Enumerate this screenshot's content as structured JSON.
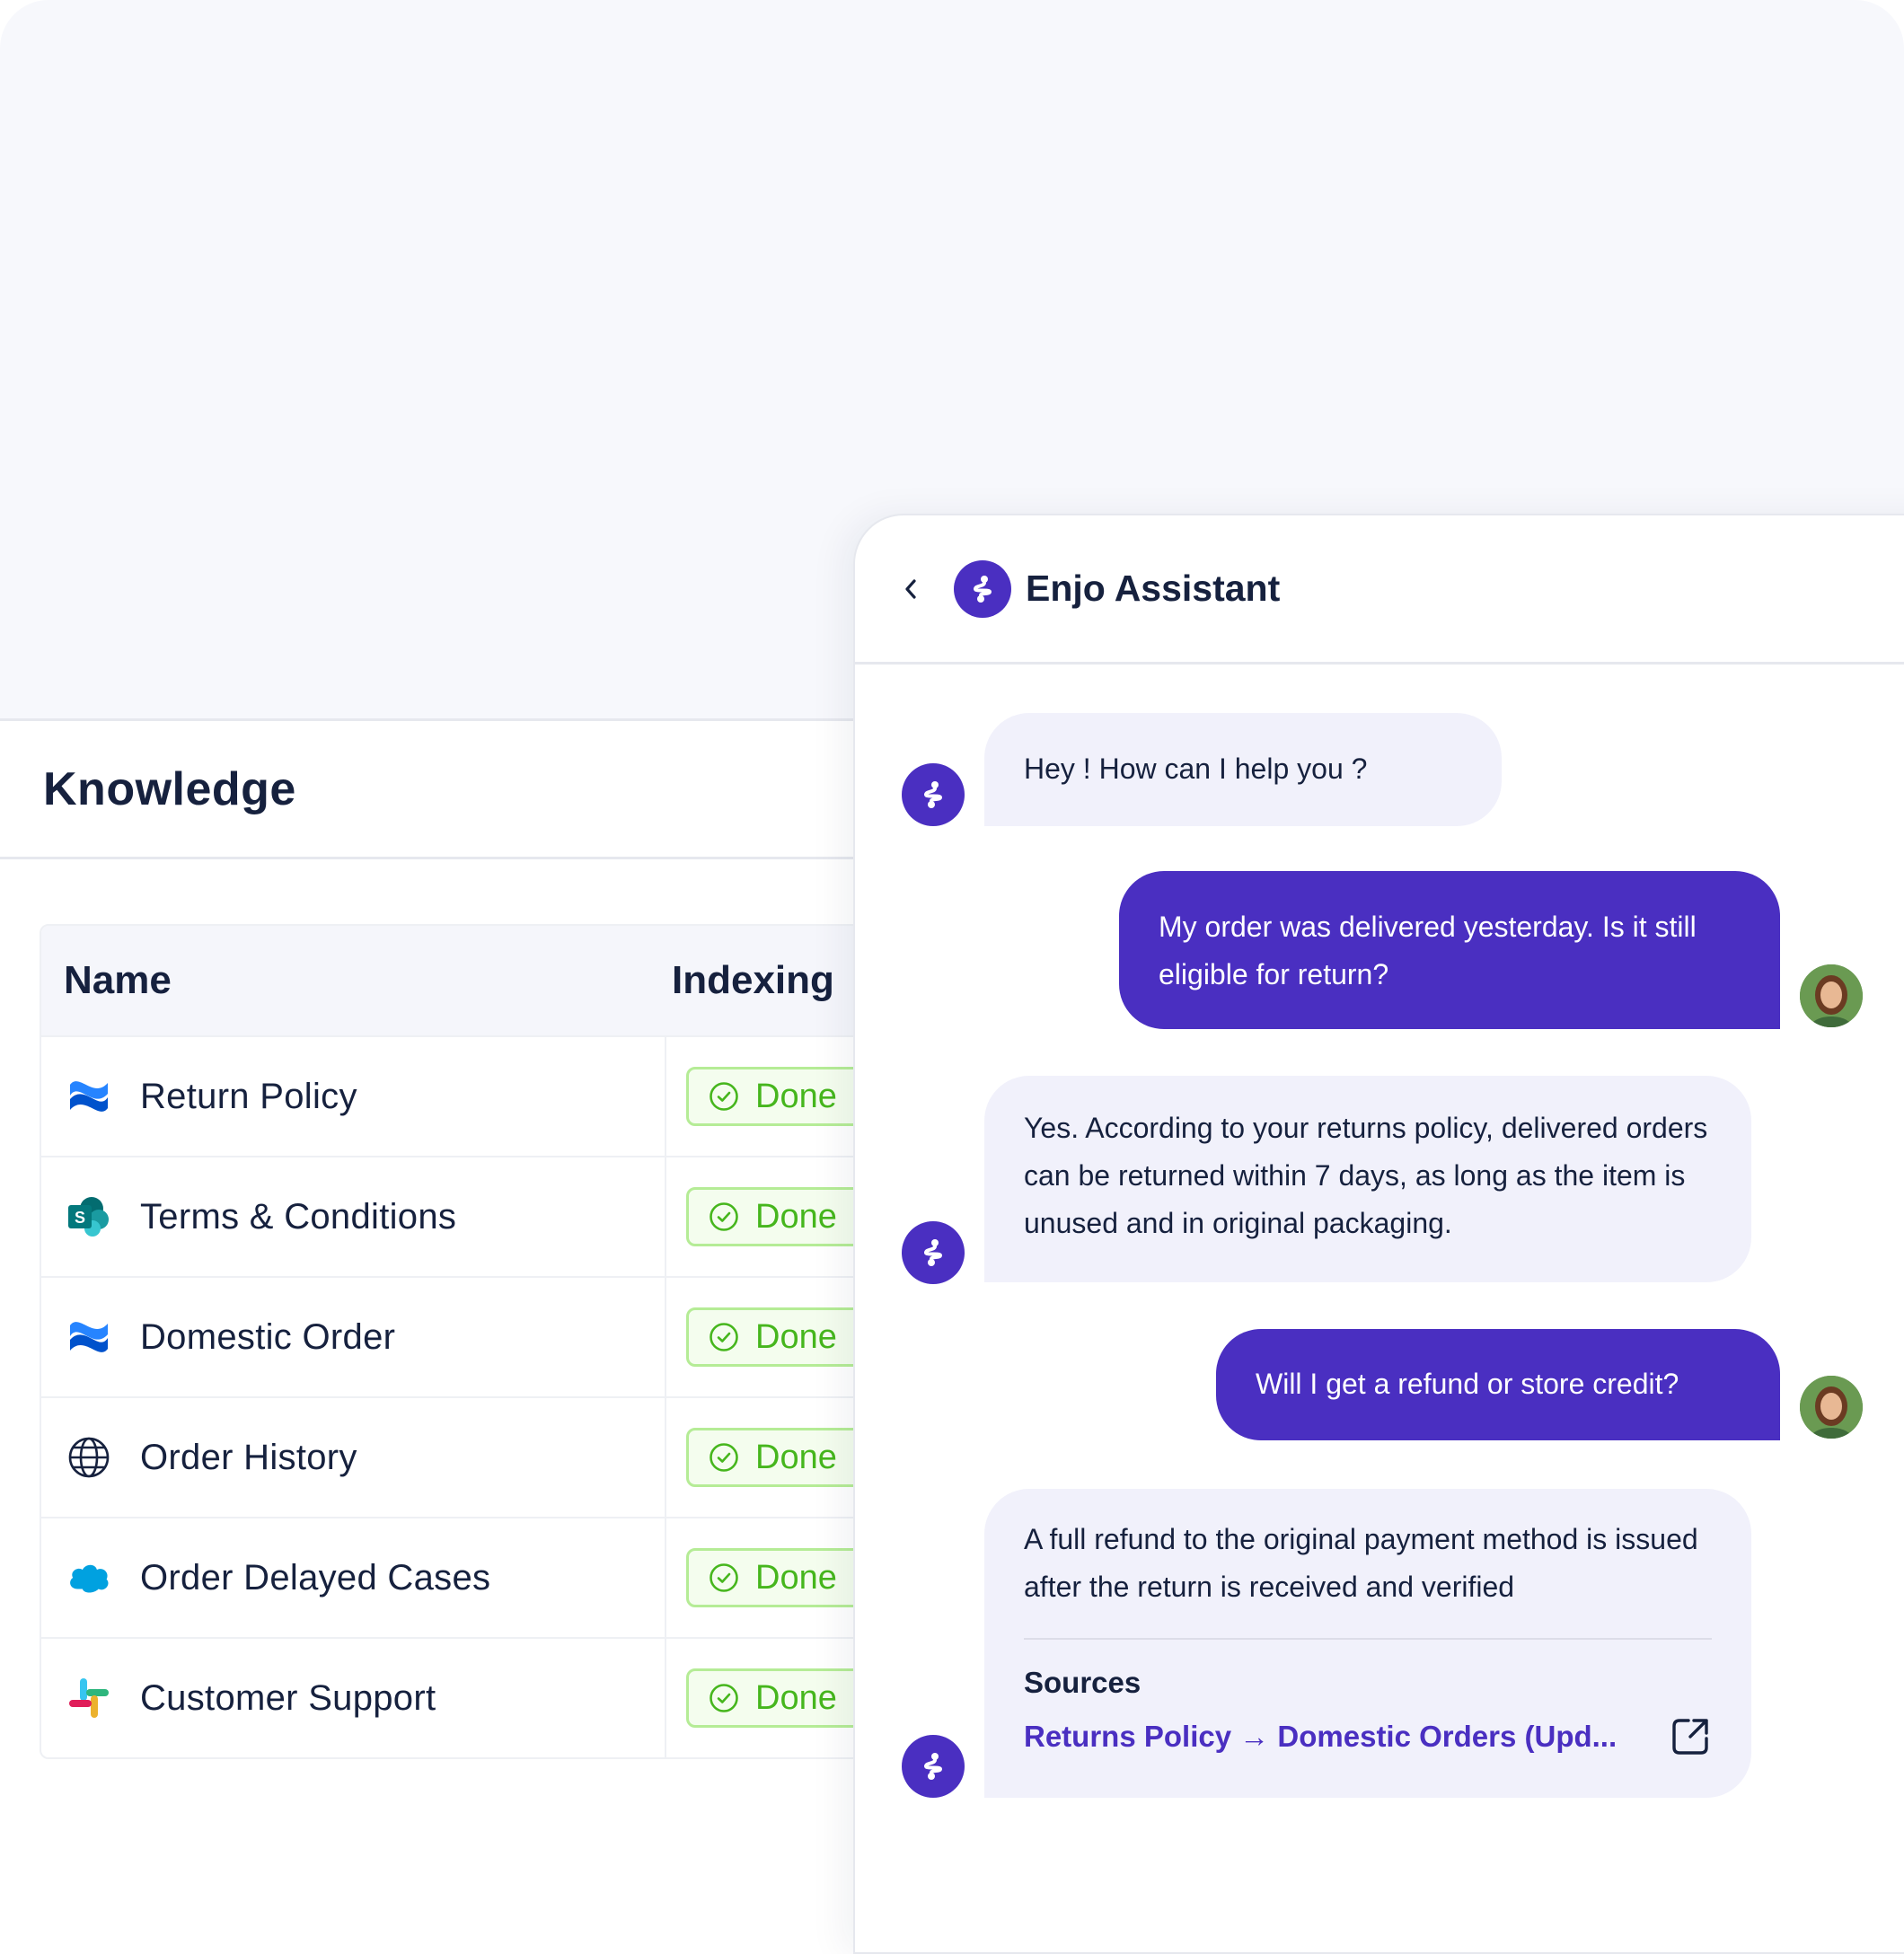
{
  "knowledge": {
    "title": "Knowledge",
    "columns": {
      "name": "Name",
      "indexing": "Indexing"
    },
    "rows": [
      {
        "name": "Return Policy",
        "status": "Done",
        "source_icon": "confluence-icon"
      },
      {
        "name": "Terms & Conditions",
        "status": "Done",
        "source_icon": "sharepoint-icon"
      },
      {
        "name": "Domestic Order",
        "status": "Done",
        "source_icon": "confluence-icon"
      },
      {
        "name": "Order History",
        "status": "Done",
        "source_icon": "globe-icon"
      },
      {
        "name": "Order Delayed Cases",
        "status": "Done",
        "source_icon": "salesforce-icon"
      },
      {
        "name": "Customer Support",
        "status": "Done",
        "source_icon": "slack-icon"
      }
    ]
  },
  "chat": {
    "title": "Enjo Assistant",
    "messages": [
      {
        "role": "bot",
        "text": "Hey ! How can I help you ?"
      },
      {
        "role": "user",
        "text": "My order was delivered yesterday. Is it still eligible for return?"
      },
      {
        "role": "bot",
        "text": "Yes. According to your returns policy, delivered orders can be returned within 7 days, as long as the item is unused and in original packaging."
      },
      {
        "role": "user",
        "text": "Will I get a refund or store credit?"
      },
      {
        "role": "bot",
        "text": "A full refund to the original payment method is issued after the return is received and verified"
      }
    ],
    "sources": {
      "title": "Sources",
      "link": "Returns Policy → Domestic Orders (Upd..."
    }
  },
  "colors": {
    "brand": "#4a2fc1",
    "done_text": "#46b61d",
    "done_border": "#b5ec96",
    "bot_bubble": "#f1f1fb"
  }
}
